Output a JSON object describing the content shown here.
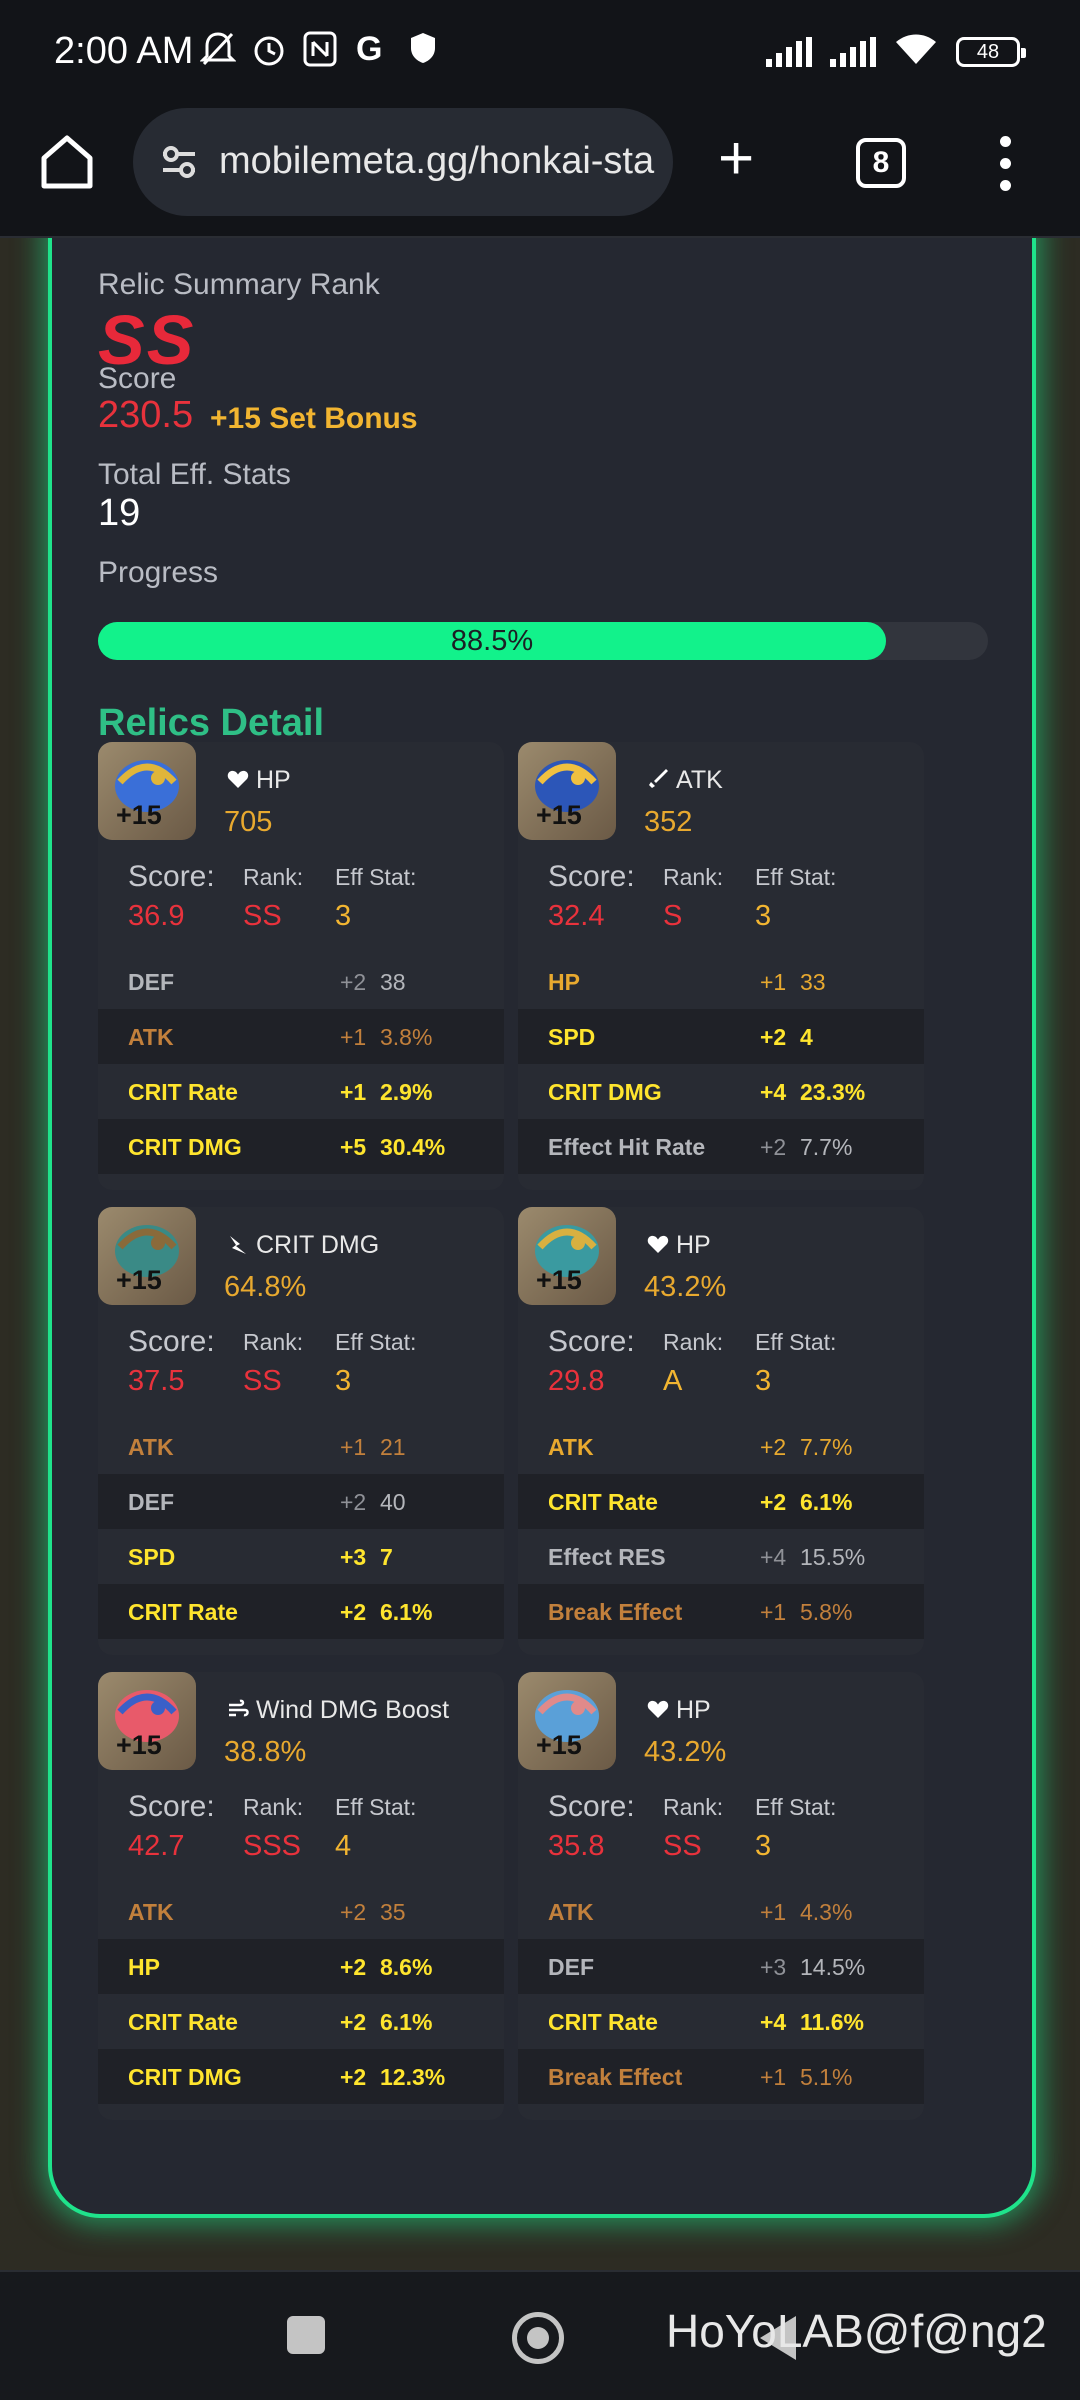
{
  "status_bar": {
    "time": "2:00 AM",
    "icons": [
      "bell-off-icon",
      "alarm-icon",
      "nfc-icon",
      "google-icon",
      "shield-icon"
    ],
    "battery": "48"
  },
  "browser": {
    "url": "mobilemeta.gg/honkai-sta",
    "tab_count": "8"
  },
  "summary": {
    "rank_label": "Relic Summary Rank",
    "rank_value": "SS",
    "score_label": "Score",
    "score_value": "230.5",
    "score_bonus": "+15 Set Bonus",
    "eff_label": "Total Eff. Stats",
    "eff_value": "19",
    "progress_label": "Progress",
    "progress_text": "88.5%",
    "progress_percent": 88.5
  },
  "relics_title": "Relics Detail",
  "relics": [
    {
      "level": "+15",
      "main_icon": "heart-icon",
      "main_stat": "HP",
      "main_value": "705",
      "score_label": "Score:",
      "rank_label": "Rank:",
      "eff_label": "Eff Stat:",
      "score": "36.9",
      "rank": "SS",
      "eff": "3",
      "substats": [
        {
          "name": "DEF",
          "roll": "+2",
          "value": "38",
          "color": "#b4b6bb"
        },
        {
          "name": "ATK",
          "roll": "+1",
          "value": "3.8%",
          "color": "#c2803c"
        },
        {
          "name": "CRIT Rate",
          "roll": "+1",
          "value": "2.9%",
          "color": "#ffe52e"
        },
        {
          "name": "CRIT DMG",
          "roll": "+5",
          "value": "30.4%",
          "color": "#ffe52e"
        }
      ]
    },
    {
      "level": "+15",
      "main_icon": "sword-icon",
      "main_stat": "ATK",
      "main_value": "352",
      "score_label": "Score:",
      "rank_label": "Rank:",
      "eff_label": "Eff Stat:",
      "score": "32.4",
      "rank": "S",
      "eff": "3",
      "substats": [
        {
          "name": "HP",
          "roll": "+1",
          "value": "33",
          "color": "#e8a92f"
        },
        {
          "name": "SPD",
          "roll": "+2",
          "value": "4",
          "color": "#ffe52e"
        },
        {
          "name": "CRIT DMG",
          "roll": "+4",
          "value": "23.3%",
          "color": "#ffe52e"
        },
        {
          "name": "Effect Hit Rate",
          "roll": "+2",
          "value": "7.7%",
          "color": "#b4b6bb"
        }
      ]
    },
    {
      "level": "+15",
      "main_icon": "crit-dmg-icon",
      "main_stat": "CRIT DMG",
      "main_value": "64.8%",
      "score_label": "Score:",
      "rank_label": "Rank:",
      "eff_label": "Eff Stat:",
      "score": "37.5",
      "rank": "SS",
      "eff": "3",
      "substats": [
        {
          "name": "ATK",
          "roll": "+1",
          "value": "21",
          "color": "#c2803c"
        },
        {
          "name": "DEF",
          "roll": "+2",
          "value": "40",
          "color": "#b4b6bb"
        },
        {
          "name": "SPD",
          "roll": "+3",
          "value": "7",
          "color": "#ffe52e"
        },
        {
          "name": "CRIT Rate",
          "roll": "+2",
          "value": "6.1%",
          "color": "#ffe52e"
        }
      ]
    },
    {
      "level": "+15",
      "main_icon": "heart-icon",
      "main_stat": "HP",
      "main_value": "43.2%",
      "score_label": "Score:",
      "rank_label": "Rank:",
      "eff_label": "Eff Stat:",
      "score": "29.8",
      "rank": "A",
      "eff": "3",
      "substats": [
        {
          "name": "ATK",
          "roll": "+2",
          "value": "7.7%",
          "color": "#e8a92f"
        },
        {
          "name": "CRIT Rate",
          "roll": "+2",
          "value": "6.1%",
          "color": "#ffe52e"
        },
        {
          "name": "Effect RES",
          "roll": "+4",
          "value": "15.5%",
          "color": "#b4b6bb"
        },
        {
          "name": "Break Effect",
          "roll": "+1",
          "value": "5.8%",
          "color": "#c2803c"
        }
      ]
    },
    {
      "level": "+15",
      "main_icon": "wind-icon",
      "main_stat": "Wind DMG Boost",
      "main_value": "38.8%",
      "score_label": "Score:",
      "rank_label": "Rank:",
      "eff_label": "Eff Stat:",
      "score": "42.7",
      "rank": "SSS",
      "eff": "4",
      "substats": [
        {
          "name": "ATK",
          "roll": "+2",
          "value": "35",
          "color": "#c2803c"
        },
        {
          "name": "HP",
          "roll": "+2",
          "value": "8.6%",
          "color": "#ffe52e"
        },
        {
          "name": "CRIT Rate",
          "roll": "+2",
          "value": "6.1%",
          "color": "#ffe52e"
        },
        {
          "name": "CRIT DMG",
          "roll": "+2",
          "value": "12.3%",
          "color": "#ffe52e"
        }
      ]
    },
    {
      "level": "+15",
      "main_icon": "heart-icon",
      "main_stat": "HP",
      "main_value": "43.2%",
      "score_label": "Score:",
      "rank_label": "Rank:",
      "eff_label": "Eff Stat:",
      "score": "35.8",
      "rank": "SS",
      "eff": "3",
      "substats": [
        {
          "name": "ATK",
          "roll": "+1",
          "value": "4.3%",
          "color": "#c2803c"
        },
        {
          "name": "DEF",
          "roll": "+3",
          "value": "14.5%",
          "color": "#b4b6bb"
        },
        {
          "name": "CRIT Rate",
          "roll": "+4",
          "value": "11.6%",
          "color": "#ffe52e"
        },
        {
          "name": "Break Effect",
          "roll": "+1",
          "value": "5.1%",
          "color": "#c2803c"
        }
      ]
    }
  ],
  "watermark": "HoYoLAB@f@ng2"
}
